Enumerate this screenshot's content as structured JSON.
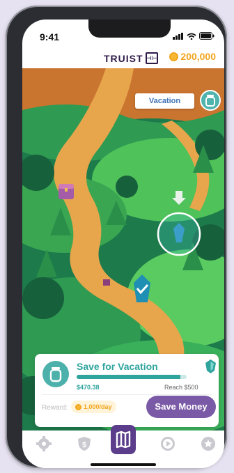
{
  "status": {
    "time": "9:41"
  },
  "header": {
    "brand": "TRUIST",
    "coins": "200,000"
  },
  "map": {
    "goal_label": "Vacation"
  },
  "goal_card": {
    "title": "Save for Vacation",
    "saved": "$470.38",
    "reach": "Reach $500",
    "progress": 0.94,
    "reward_label": "Reward:",
    "reward_value": "1,000/day",
    "cta": "Save Money"
  },
  "colors": {
    "accent": "#7a5aa6",
    "teal": "#2fa49d",
    "gold": "#f2a51d",
    "brand": "#2e1a47"
  },
  "tabs": [
    {
      "icon": "gear-icon"
    },
    {
      "icon": "shield-dollar-icon"
    },
    {
      "icon": "map-icon",
      "active": true
    },
    {
      "icon": "play-icon"
    },
    {
      "icon": "star-icon"
    }
  ]
}
